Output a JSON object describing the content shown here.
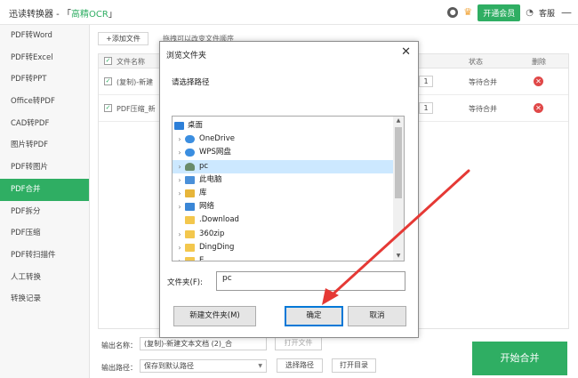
{
  "titlebar": {
    "app_name": "迅读转换器 - 「",
    "ocr_tag": "高精OCR",
    "suffix": "」",
    "member_label": "开通会员",
    "service_label": "客服"
  },
  "sidebar": {
    "items": [
      {
        "label": "PDF转Word"
      },
      {
        "label": "PDF转Excel"
      },
      {
        "label": "PDF转PPT"
      },
      {
        "label": "Office转PDF"
      },
      {
        "label": "CAD转PDF"
      },
      {
        "label": "图片转PDF"
      },
      {
        "label": "PDF转图片"
      },
      {
        "label": "PDF合并",
        "active": true
      },
      {
        "label": "PDF拆分"
      },
      {
        "label": "PDF压缩"
      },
      {
        "label": "PDF转扫描件"
      },
      {
        "label": "人工转换"
      },
      {
        "label": "转换记录"
      }
    ]
  },
  "main": {
    "add_file_label": "+添加文件",
    "drag_hint": "拖拽可以改变文件顺序",
    "columns": {
      "name": "文件名称",
      "status": "状态",
      "delete": "删除"
    },
    "rows": [
      {
        "name": "(复制)-新建",
        "page": "1",
        "status": "等待合并"
      },
      {
        "name": "PDF压缩_新",
        "page": "1",
        "status": "等待合并"
      }
    ],
    "output_name_label": "输出名称：",
    "output_name_value": "(复制)-新建文本文档 (2)_合",
    "open_folder_label": "打开文件",
    "output_path_label": "输出路径：",
    "output_path_value": "保存到默认路径",
    "choose_path_label": "选择路径",
    "open_dir_label": "打开目录",
    "merge_label": "开始合并"
  },
  "dialog": {
    "title": "浏览文件夹",
    "subtitle": "请选择路径",
    "tree": [
      {
        "label": "桌面",
        "icon": "desktop-icon",
        "chevron": false,
        "indent": 0
      },
      {
        "label": "OneDrive",
        "icon": "cloud-icon",
        "chevron": true,
        "indent": 1
      },
      {
        "label": "WPS网盘",
        "icon": "cloud-icon",
        "chevron": true,
        "indent": 1
      },
      {
        "label": "pc",
        "icon": "user-icon",
        "chevron": true,
        "indent": 1,
        "selected": true
      },
      {
        "label": "此电脑",
        "icon": "computer-icon",
        "chevron": true,
        "indent": 1
      },
      {
        "label": "库",
        "icon": "library-icon",
        "chevron": true,
        "indent": 1
      },
      {
        "label": "网络",
        "icon": "network-icon",
        "chevron": true,
        "indent": 1
      },
      {
        "label": ".Download",
        "icon": "folder-icon",
        "chevron": false,
        "indent": 1
      },
      {
        "label": "360zip",
        "icon": "folder-icon",
        "chevron": true,
        "indent": 1
      },
      {
        "label": "DingDing",
        "icon": "folder-icon",
        "chevron": true,
        "indent": 1
      },
      {
        "label": "E...",
        "icon": "folder-icon",
        "chevron": true,
        "indent": 1
      }
    ],
    "folder_label": "文件夹(F):",
    "folder_value": "pc",
    "new_folder_label": "新建文件夹(M)",
    "ok_label": "确定",
    "cancel_label": "取消"
  },
  "colors": {
    "accent": "#2fae63",
    "arrow": "#e53935",
    "delete": "#e04848"
  }
}
